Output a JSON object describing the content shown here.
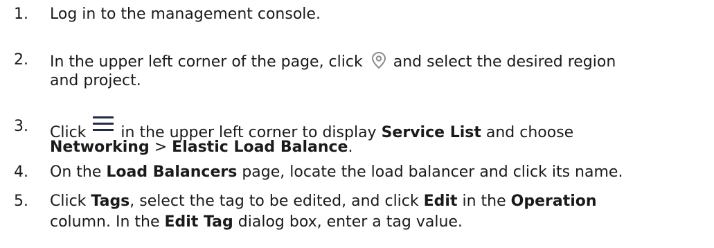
{
  "steps": [
    {
      "number": "1.",
      "text": "Log in to the management console."
    },
    {
      "number": "2.",
      "text_a": "In the upper left corner of the page, click",
      "icon": "location-pin-icon",
      "text_b": "and select the desired region",
      "text_c": "and project."
    },
    {
      "number": "3.",
      "text_a": "Click",
      "icon": "hamburger-menu-icon",
      "text_b": "in the upper left corner to display",
      "bold_service_list": "Service List",
      "text_c": "and choose",
      "bold_networking": "Networking",
      "separator": ">",
      "bold_elb": "Elastic Load Balance",
      "period": "."
    },
    {
      "number": "4.",
      "text_a": "On the",
      "bold_load_balancers": "Load Balancers",
      "text_b": "page, locate the load balancer and click its name."
    },
    {
      "number": "5.",
      "text_a": "Click",
      "bold_tags": "Tags",
      "text_b": ", select the tag to be edited, and click",
      "bold_edit": "Edit",
      "text_c": "in the",
      "bold_operation": "Operation",
      "text_d": "column. In the",
      "bold_edit_tag": "Edit Tag",
      "text_e": "dialog box, enter a tag value."
    }
  ],
  "colors": {
    "text": "#1a1a1a",
    "icon_pin": "#8a8a8a",
    "icon_menu": "#1f2a44"
  }
}
